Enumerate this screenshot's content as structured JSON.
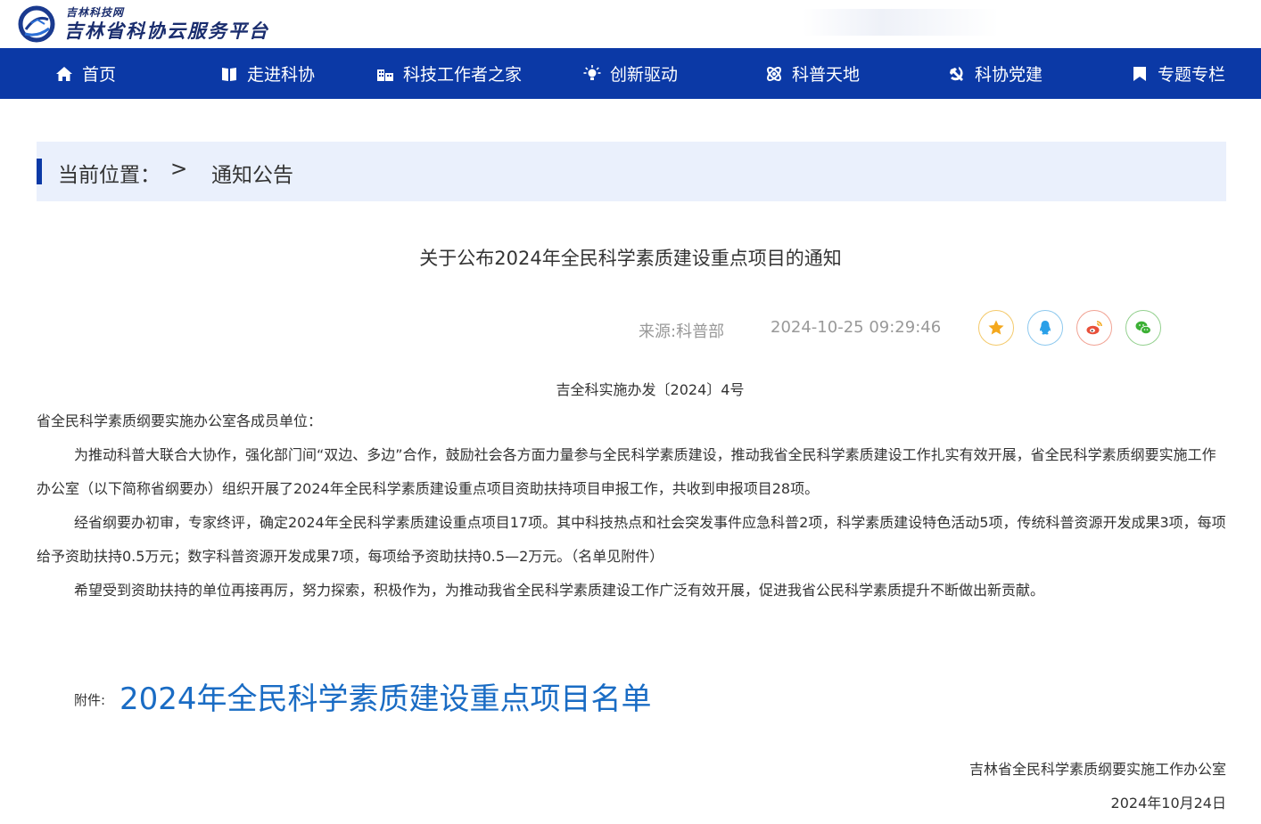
{
  "header": {
    "logo_small": "吉林科技网",
    "logo_main": "吉林省科协云服务平台"
  },
  "nav": {
    "items": [
      {
        "label": "首页",
        "icon": "home-icon"
      },
      {
        "label": "走进科协",
        "icon": "book-icon"
      },
      {
        "label": "科技工作者之家",
        "icon": "building-icon"
      },
      {
        "label": "创新驱动",
        "icon": "lightbulb-icon"
      },
      {
        "label": "科普天地",
        "icon": "atom-icon"
      },
      {
        "label": "科协党建",
        "icon": "hammer-sickle-icon"
      },
      {
        "label": "专题专栏",
        "icon": "bookmark-icon"
      }
    ]
  },
  "breadcrumb": {
    "label": "当前位置：",
    "separator": ">",
    "current": "通知公告"
  },
  "article": {
    "title": "关于公布2024年全民科学素质建设重点项目的通知",
    "source": "来源:科普部",
    "date": "2024-10-25 09:29:46",
    "share_icons": [
      "favorite-star-icon",
      "qq-icon",
      "weibo-icon",
      "wechat-icon"
    ],
    "doc_number": "吉全科实施办发〔2024〕4号",
    "recipient": "省全民科学素质纲要实施办公室各成员单位：",
    "paragraphs": [
      "为推动科普大联合大协作，强化部门间“双边、多边”合作，鼓励社会各方面力量参与全民科学素质建设，推动我省全民科学素质建设工作扎实有效开展，省全民科学素质纲要实施工作办公室（以下简称省纲要办）组织开展了2024年全民科学素质建设重点项目资助扶持项目申报工作，共收到申报项目28项。",
      "经省纲要办初审，专家终评，确定2024年全民科学素质建设重点项目17项。其中科技热点和社会突发事件应急科普2项，科学素质建设特色活动5项，传统科普资源开发成果3项，每项给予资助扶持0.5万元；数字科普资源开发成果7项，每项给予资助扶持0.5—2万元。（名单见附件）",
      "希望受到资助扶持的单位再接再厉，努力探索，积极作为，为推动我省全民科学素质建设工作广泛有效开展，促进我省公民科学素质提升不断做出新贡献。"
    ],
    "attachment_label": "附件:",
    "attachment_link": "2024年全民科学素质建设重点项目名单",
    "signature_org": "吉林省全民科学素质纲要实施工作办公室",
    "signature_date": "2024年10月24日"
  },
  "colors": {
    "nav_bg": "#0b39a6",
    "breadcrumb_bg": "#eaf0fc",
    "link": "#1a6cc4",
    "meta_text": "#999999",
    "star": "#f4a81d",
    "qq": "#2aa0e8",
    "weibo": "#e8503a",
    "wechat": "#3cb035"
  }
}
